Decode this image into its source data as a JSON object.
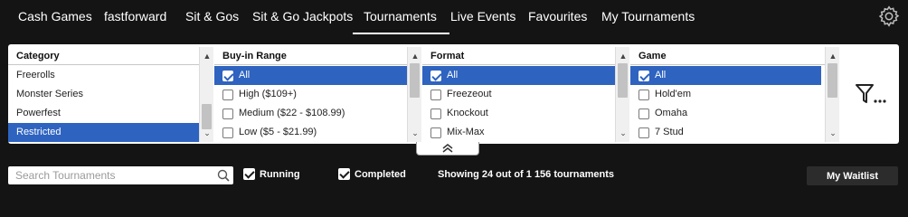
{
  "nav": {
    "tabs": [
      {
        "label": "Cash Games"
      },
      {
        "label": "fastforward"
      },
      {
        "label": "Sit & Gos"
      },
      {
        "label": "Sit & Go Jackpots"
      },
      {
        "label": "Tournaments",
        "active": true
      },
      {
        "label": "Live Events"
      },
      {
        "label": "Favourites"
      },
      {
        "label": "My Tournaments"
      }
    ],
    "settings_icon": "gear-icon"
  },
  "filters": {
    "category": {
      "header": "Category",
      "items": [
        {
          "label": "Freerolls",
          "selected": false
        },
        {
          "label": "Monster Series",
          "selected": false
        },
        {
          "label": "Powerfest",
          "selected": false
        },
        {
          "label": "Restricted",
          "selected": true
        }
      ]
    },
    "buyin": {
      "header": "Buy-in Range",
      "items": [
        {
          "label": "All",
          "checked": true,
          "selected": true
        },
        {
          "label": "High ($109+)",
          "checked": false,
          "selected": false
        },
        {
          "label": "Medium ($22 - $108.99)",
          "checked": false,
          "selected": false
        },
        {
          "label": "Low ($5 - $21.99)",
          "checked": false,
          "selected": false
        }
      ]
    },
    "format": {
      "header": "Format",
      "items": [
        {
          "label": "All",
          "checked": true,
          "selected": true
        },
        {
          "label": "Freezeout",
          "checked": false,
          "selected": false
        },
        {
          "label": "Knockout",
          "checked": false,
          "selected": false
        },
        {
          "label": "Mix-Max",
          "checked": false,
          "selected": false
        }
      ]
    },
    "game": {
      "header": "Game",
      "items": [
        {
          "label": "All",
          "checked": true,
          "selected": true
        },
        {
          "label": "Hold'em",
          "checked": false,
          "selected": false
        },
        {
          "label": "Omaha",
          "checked": false,
          "selected": false
        },
        {
          "label": "7 Stud",
          "checked": false,
          "selected": false
        }
      ]
    },
    "more_filters_icon": "filter-more-icon",
    "collapse_icon": "chevron-up-double-icon"
  },
  "bottom": {
    "search_placeholder": "Search Tournaments",
    "search_value": "",
    "running_label": "Running",
    "running_checked": true,
    "completed_label": "Completed",
    "completed_checked": true,
    "status": "Showing 24 out of 1 156 tournaments",
    "waitlist_label": "My Waitlist"
  },
  "colors": {
    "background": "#141414",
    "selection": "#2e63c0",
    "panel": "#ffffff"
  }
}
